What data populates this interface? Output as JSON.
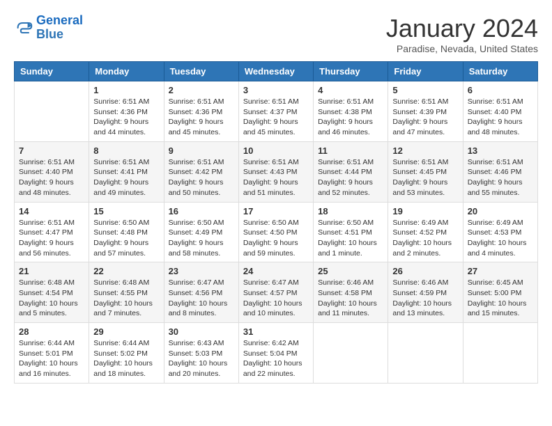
{
  "header": {
    "logo": {
      "line1": "General",
      "line2": "Blue"
    },
    "title": "January 2024",
    "subtitle": "Paradise, Nevada, United States"
  },
  "days_of_week": [
    "Sunday",
    "Monday",
    "Tuesday",
    "Wednesday",
    "Thursday",
    "Friday",
    "Saturday"
  ],
  "weeks": [
    [
      {
        "day": "",
        "sunrise": "",
        "sunset": "",
        "daylight": ""
      },
      {
        "day": "1",
        "sunrise": "Sunrise: 6:51 AM",
        "sunset": "Sunset: 4:36 PM",
        "daylight": "Daylight: 9 hours and 44 minutes."
      },
      {
        "day": "2",
        "sunrise": "Sunrise: 6:51 AM",
        "sunset": "Sunset: 4:36 PM",
        "daylight": "Daylight: 9 hours and 45 minutes."
      },
      {
        "day": "3",
        "sunrise": "Sunrise: 6:51 AM",
        "sunset": "Sunset: 4:37 PM",
        "daylight": "Daylight: 9 hours and 45 minutes."
      },
      {
        "day": "4",
        "sunrise": "Sunrise: 6:51 AM",
        "sunset": "Sunset: 4:38 PM",
        "daylight": "Daylight: 9 hours and 46 minutes."
      },
      {
        "day": "5",
        "sunrise": "Sunrise: 6:51 AM",
        "sunset": "Sunset: 4:39 PM",
        "daylight": "Daylight: 9 hours and 47 minutes."
      },
      {
        "day": "6",
        "sunrise": "Sunrise: 6:51 AM",
        "sunset": "Sunset: 4:40 PM",
        "daylight": "Daylight: 9 hours and 48 minutes."
      }
    ],
    [
      {
        "day": "7",
        "sunrise": "Sunrise: 6:51 AM",
        "sunset": "Sunset: 4:40 PM",
        "daylight": "Daylight: 9 hours and 48 minutes."
      },
      {
        "day": "8",
        "sunrise": "Sunrise: 6:51 AM",
        "sunset": "Sunset: 4:41 PM",
        "daylight": "Daylight: 9 hours and 49 minutes."
      },
      {
        "day": "9",
        "sunrise": "Sunrise: 6:51 AM",
        "sunset": "Sunset: 4:42 PM",
        "daylight": "Daylight: 9 hours and 50 minutes."
      },
      {
        "day": "10",
        "sunrise": "Sunrise: 6:51 AM",
        "sunset": "Sunset: 4:43 PM",
        "daylight": "Daylight: 9 hours and 51 minutes."
      },
      {
        "day": "11",
        "sunrise": "Sunrise: 6:51 AM",
        "sunset": "Sunset: 4:44 PM",
        "daylight": "Daylight: 9 hours and 52 minutes."
      },
      {
        "day": "12",
        "sunrise": "Sunrise: 6:51 AM",
        "sunset": "Sunset: 4:45 PM",
        "daylight": "Daylight: 9 hours and 53 minutes."
      },
      {
        "day": "13",
        "sunrise": "Sunrise: 6:51 AM",
        "sunset": "Sunset: 4:46 PM",
        "daylight": "Daylight: 9 hours and 55 minutes."
      }
    ],
    [
      {
        "day": "14",
        "sunrise": "Sunrise: 6:51 AM",
        "sunset": "Sunset: 4:47 PM",
        "daylight": "Daylight: 9 hours and 56 minutes."
      },
      {
        "day": "15",
        "sunrise": "Sunrise: 6:50 AM",
        "sunset": "Sunset: 4:48 PM",
        "daylight": "Daylight: 9 hours and 57 minutes."
      },
      {
        "day": "16",
        "sunrise": "Sunrise: 6:50 AM",
        "sunset": "Sunset: 4:49 PM",
        "daylight": "Daylight: 9 hours and 58 minutes."
      },
      {
        "day": "17",
        "sunrise": "Sunrise: 6:50 AM",
        "sunset": "Sunset: 4:50 PM",
        "daylight": "Daylight: 9 hours and 59 minutes."
      },
      {
        "day": "18",
        "sunrise": "Sunrise: 6:50 AM",
        "sunset": "Sunset: 4:51 PM",
        "daylight": "Daylight: 10 hours and 1 minute."
      },
      {
        "day": "19",
        "sunrise": "Sunrise: 6:49 AM",
        "sunset": "Sunset: 4:52 PM",
        "daylight": "Daylight: 10 hours and 2 minutes."
      },
      {
        "day": "20",
        "sunrise": "Sunrise: 6:49 AM",
        "sunset": "Sunset: 4:53 PM",
        "daylight": "Daylight: 10 hours and 4 minutes."
      }
    ],
    [
      {
        "day": "21",
        "sunrise": "Sunrise: 6:48 AM",
        "sunset": "Sunset: 4:54 PM",
        "daylight": "Daylight: 10 hours and 5 minutes."
      },
      {
        "day": "22",
        "sunrise": "Sunrise: 6:48 AM",
        "sunset": "Sunset: 4:55 PM",
        "daylight": "Daylight: 10 hours and 7 minutes."
      },
      {
        "day": "23",
        "sunrise": "Sunrise: 6:47 AM",
        "sunset": "Sunset: 4:56 PM",
        "daylight": "Daylight: 10 hours and 8 minutes."
      },
      {
        "day": "24",
        "sunrise": "Sunrise: 6:47 AM",
        "sunset": "Sunset: 4:57 PM",
        "daylight": "Daylight: 10 hours and 10 minutes."
      },
      {
        "day": "25",
        "sunrise": "Sunrise: 6:46 AM",
        "sunset": "Sunset: 4:58 PM",
        "daylight": "Daylight: 10 hours and 11 minutes."
      },
      {
        "day": "26",
        "sunrise": "Sunrise: 6:46 AM",
        "sunset": "Sunset: 4:59 PM",
        "daylight": "Daylight: 10 hours and 13 minutes."
      },
      {
        "day": "27",
        "sunrise": "Sunrise: 6:45 AM",
        "sunset": "Sunset: 5:00 PM",
        "daylight": "Daylight: 10 hours and 15 minutes."
      }
    ],
    [
      {
        "day": "28",
        "sunrise": "Sunrise: 6:44 AM",
        "sunset": "Sunset: 5:01 PM",
        "daylight": "Daylight: 10 hours and 16 minutes."
      },
      {
        "day": "29",
        "sunrise": "Sunrise: 6:44 AM",
        "sunset": "Sunset: 5:02 PM",
        "daylight": "Daylight: 10 hours and 18 minutes."
      },
      {
        "day": "30",
        "sunrise": "Sunrise: 6:43 AM",
        "sunset": "Sunset: 5:03 PM",
        "daylight": "Daylight: 10 hours and 20 minutes."
      },
      {
        "day": "31",
        "sunrise": "Sunrise: 6:42 AM",
        "sunset": "Sunset: 5:04 PM",
        "daylight": "Daylight: 10 hours and 22 minutes."
      },
      {
        "day": "",
        "sunrise": "",
        "sunset": "",
        "daylight": ""
      },
      {
        "day": "",
        "sunrise": "",
        "sunset": "",
        "daylight": ""
      },
      {
        "day": "",
        "sunrise": "",
        "sunset": "",
        "daylight": ""
      }
    ]
  ]
}
